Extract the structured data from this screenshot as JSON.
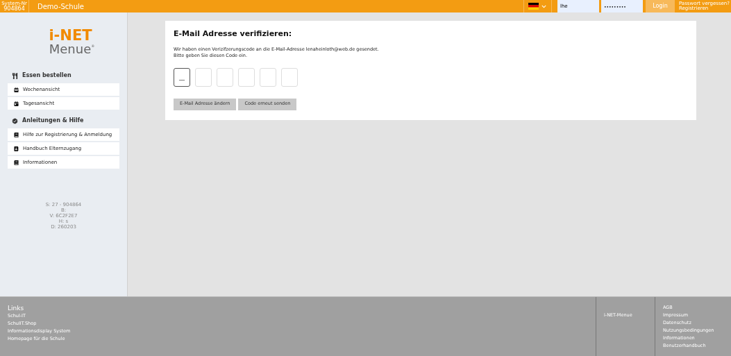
{
  "header": {
    "system_label": "System-Nr",
    "system_number": "904864",
    "school": "Demo-Schule",
    "username": "lhe",
    "password": "•••••••••",
    "login_button": "Login",
    "forgot_link": "Passwort vergessen?",
    "register_link": "Registrieren"
  },
  "logo": {
    "top": "i-NET",
    "bottom": "Menue",
    "mark": "®"
  },
  "sidebar": [
    {
      "title": "Essen bestellen",
      "items": [
        {
          "label": "Wochenansicht"
        },
        {
          "label": "Tagesansicht"
        }
      ]
    },
    {
      "title": "Anleitungen & Hilfe",
      "items": [
        {
          "label": "Hilfe zur Registrierung & Anmeldung"
        },
        {
          "label": "Handbuch Elternzugang"
        },
        {
          "label": "Informationen"
        }
      ]
    }
  ],
  "version_info": [
    "S: 27 - 904864",
    "B:",
    "V: 6C2F2E7",
    "H: s",
    "D: 260203"
  ],
  "verify": {
    "title": "E-Mail Adresse verifizieren:",
    "message": [
      "Wir haben einen Verizifzerungscode an die E-Mail-Adresse lenaheinloth@web.de gesendet.",
      "Bitte geben Sie diesen Code ein."
    ],
    "code_fields": [
      {
        "focused": true,
        "placeholder": "__"
      },
      {
        "focused": false
      },
      {
        "focused": false
      },
      {
        "focused": false
      },
      {
        "focused": false
      },
      {
        "focused": false
      }
    ],
    "buttons": [
      "E-Mail Adresse ändern",
      "Code erneut senden"
    ]
  },
  "footer": {
    "links_title": "Links",
    "links": [
      "Schul-IT",
      "SchulIT.Shop",
      "Informationsdisplay System",
      "Homepage für die Schule"
    ],
    "brand": "i-NET-Menue",
    "legal_links": [
      "AGB",
      "Impressum",
      "Datenschutz",
      "Nutzungsbedingungen",
      "Informationen",
      "Benutzerhandbuch"
    ]
  }
}
